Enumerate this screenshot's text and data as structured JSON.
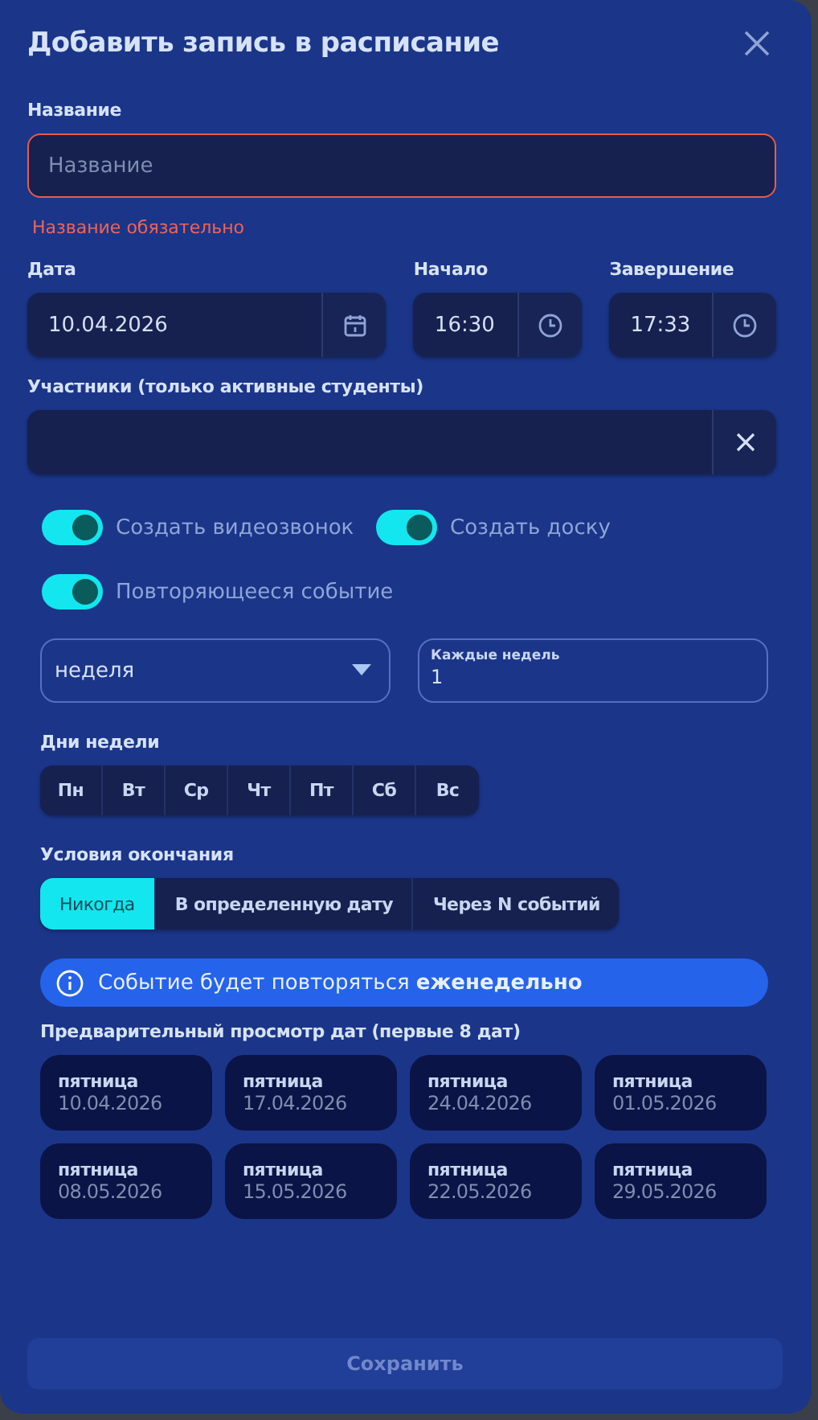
{
  "dialog": {
    "title": "Добавить запись в расписание"
  },
  "name_field": {
    "label": "Название",
    "placeholder": "Название",
    "error": "Название обязательно",
    "invalid": true
  },
  "date_field": {
    "label": "Дата",
    "value": "10.04.2026"
  },
  "start_field": {
    "label": "Начало",
    "value": "16:30"
  },
  "end_field": {
    "label": "Завершение",
    "value": "17:33"
  },
  "participants_field": {
    "label": "Участники (только активные студенты)"
  },
  "toggles": [
    {
      "label": "Создать видеозвонок",
      "on": true
    },
    {
      "label": "Создать доску",
      "on": true
    },
    {
      "label": "Повторяющееся событие",
      "on": true
    }
  ],
  "repeat_unit": {
    "value": "неделя"
  },
  "interval_field": {
    "label": "Каждые недель",
    "value": "1"
  },
  "weekdays": {
    "label": "Дни недели",
    "days": [
      {
        "label": "Пн",
        "selected": false
      },
      {
        "label": "Вт",
        "selected": false
      },
      {
        "label": "Ср",
        "selected": false
      },
      {
        "label": "Чт",
        "selected": false
      },
      {
        "label": "Пт",
        "selected": false
      },
      {
        "label": "Сб",
        "selected": false
      },
      {
        "label": "Вс",
        "selected": false
      }
    ]
  },
  "end_conditions": {
    "label": "Условия окончания",
    "options": [
      {
        "label": "Никогда",
        "selected": true
      },
      {
        "label": "В определенную дату",
        "selected": false
      },
      {
        "label": "Через N событий",
        "selected": false
      }
    ]
  },
  "info": {
    "text": "Событие будет повторяться **еженедельно**"
  },
  "preview": {
    "label": "Предварительный просмотр дат (первые 8 дат)",
    "dates": [
      {
        "weekday": "пятница",
        "date": "10.04.2026"
      },
      {
        "weekday": "пятница",
        "date": "17.04.2026"
      },
      {
        "weekday": "пятница",
        "date": "24.04.2026"
      },
      {
        "weekday": "пятница",
        "date": "01.05.2026"
      },
      {
        "weekday": "пятница",
        "date": "08.05.2026"
      },
      {
        "weekday": "пятница",
        "date": "15.05.2026"
      },
      {
        "weekday": "пятница",
        "date": "22.05.2026"
      },
      {
        "weekday": "пятница",
        "date": "29.05.2026"
      }
    ]
  },
  "save_button": {
    "label": "Сохранить",
    "disabled": true
  }
}
